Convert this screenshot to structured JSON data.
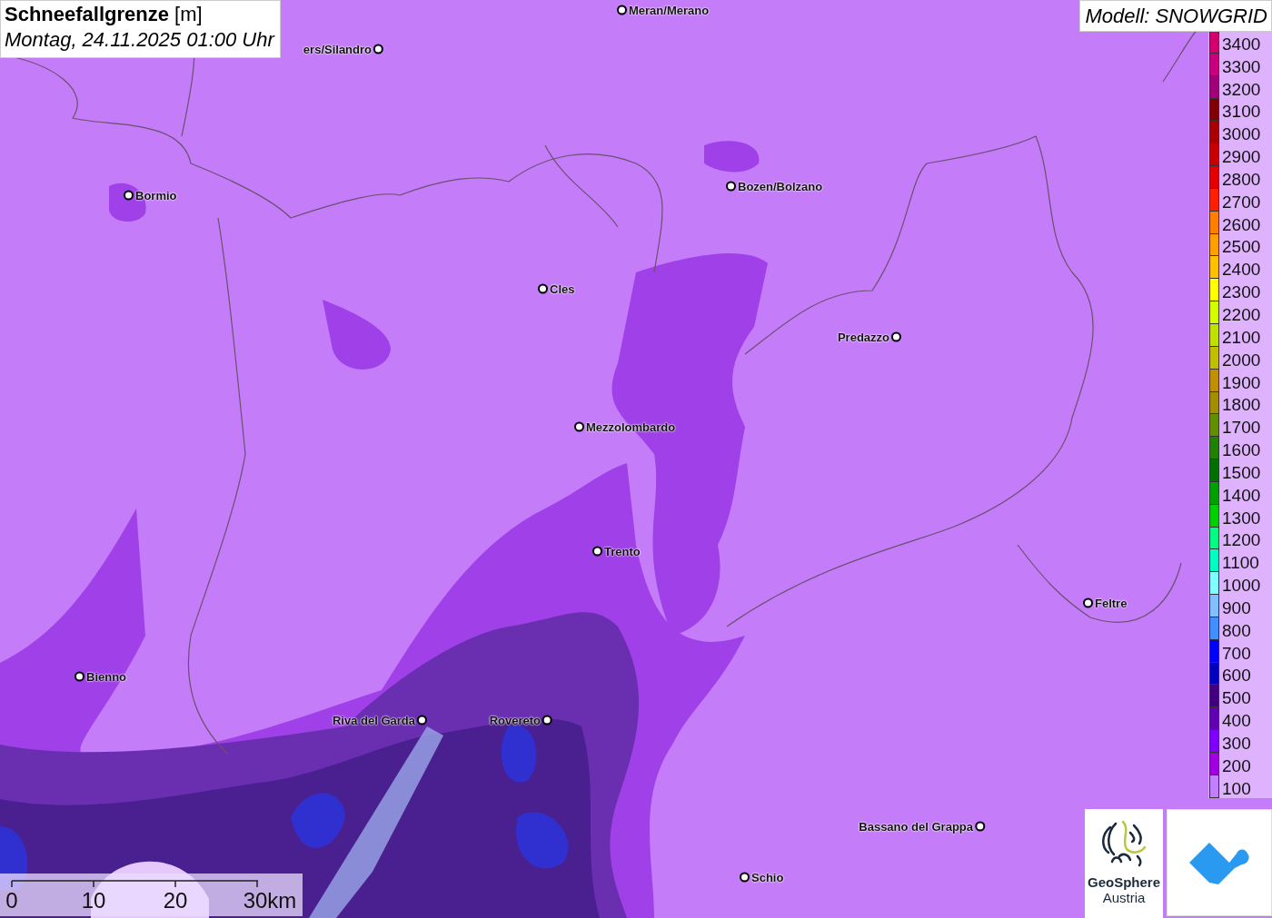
{
  "title": {
    "heading": "**Schneefallgrenze** [m]",
    "time": "Montag, 24.11.2025 01:00 Uhr"
  },
  "model": "Modell: SNOWGRID",
  "places": [
    {
      "name": "Meran/Merano"
    },
    {
      "name": "ers/Silandro"
    },
    {
      "name": "Bormio"
    },
    {
      "name": "Bozen/Bolzano"
    },
    {
      "name": "Cles"
    },
    {
      "name": "Predazzo"
    },
    {
      "name": "Mezzolombardo"
    },
    {
      "name": "Trento"
    },
    {
      "name": "Feltre"
    },
    {
      "name": "Bienno"
    },
    {
      "name": "Riva del Garda"
    },
    {
      "name": "Rovereto"
    },
    {
      "name": "Bassano del Grappa"
    },
    {
      "name": "Schio"
    }
  ],
  "legend": [
    {
      "label": "3400",
      "color": "#d4006e"
    },
    {
      "label": "3300",
      "color": "#c8007c"
    },
    {
      "label": "3200",
      "color": "#a00078"
    },
    {
      "label": "3100",
      "color": "#800000"
    },
    {
      "label": "3000",
      "color": "#a80000"
    },
    {
      "label": "2900",
      "color": "#c80000"
    },
    {
      "label": "2800",
      "color": "#e40000"
    },
    {
      "label": "2700",
      "color": "#ff2000"
    },
    {
      "label": "2600",
      "color": "#ff8000"
    },
    {
      "label": "2500",
      "color": "#ffa000"
    },
    {
      "label": "2400",
      "color": "#ffc000"
    },
    {
      "label": "2300",
      "color": "#ffff00"
    },
    {
      "label": "2200",
      "color": "#d4ff00"
    },
    {
      "label": "2100",
      "color": "#c0e000"
    },
    {
      "label": "2000",
      "color": "#c0c000"
    },
    {
      "label": "1900",
      "color": "#c09000"
    },
    {
      "label": "1800",
      "color": "#a09000"
    },
    {
      "label": "1700",
      "color": "#609000"
    },
    {
      "label": "1600",
      "color": "#208000"
    },
    {
      "label": "1500",
      "color": "#007000"
    },
    {
      "label": "1400",
      "color": "#00a000"
    },
    {
      "label": "1300",
      "color": "#00d000"
    },
    {
      "label": "1200",
      "color": "#00ff80"
    },
    {
      "label": "1100",
      "color": "#00ffc0"
    },
    {
      "label": "1000",
      "color": "#80ffff"
    },
    {
      "label": "900",
      "color": "#80c0ff"
    },
    {
      "label": "800",
      "color": "#4090ff"
    },
    {
      "label": "700",
      "color": "#0000ff"
    },
    {
      "label": "600",
      "color": "#0000c0"
    },
    {
      "label": "500",
      "color": "#400080"
    },
    {
      "label": "400",
      "color": "#6000b0"
    },
    {
      "label": "300",
      "color": "#8000ff"
    },
    {
      "label": "200",
      "color": "#a000e0"
    },
    {
      "label": "100",
      "color": "#c080ff"
    }
  ],
  "scale": [
    "0",
    "10",
    "20",
    "30km"
  ],
  "logo": {
    "name": "GeoSphere",
    "sub": "Austria"
  }
}
